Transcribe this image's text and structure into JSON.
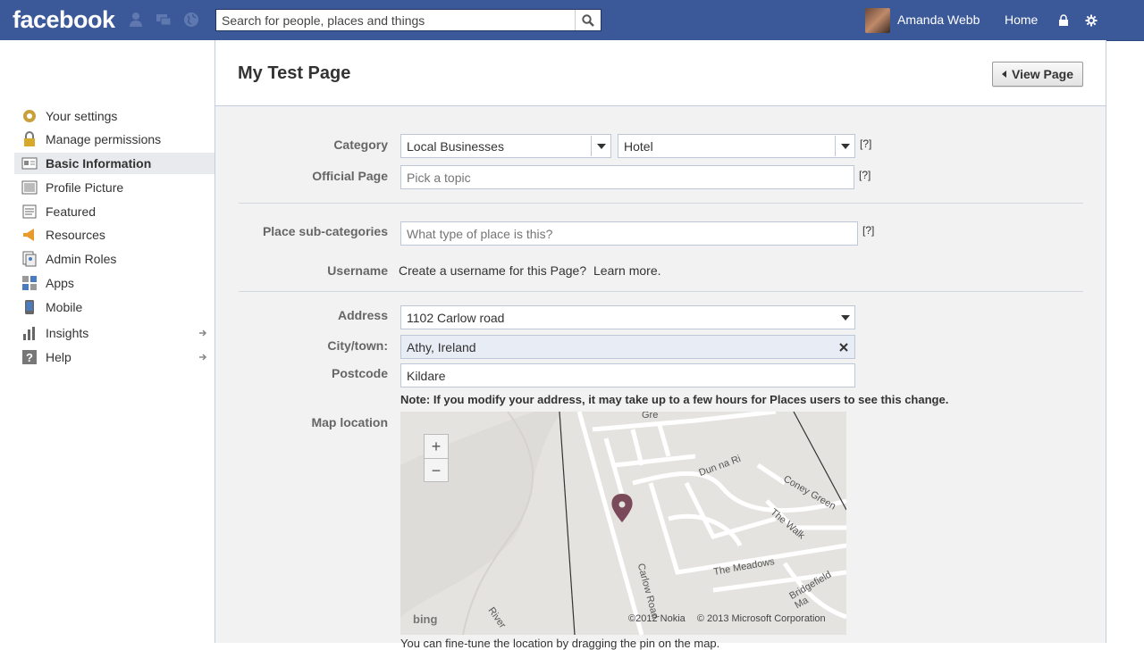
{
  "topbar": {
    "logo": "facebook",
    "search_placeholder": "Search for people, places and things",
    "user_name": "Amanda Webb",
    "home_label": "Home"
  },
  "sidebar": {
    "items": [
      {
        "label": "Your settings",
        "icon": "gear-icon"
      },
      {
        "label": "Manage permissions",
        "icon": "lock-icon"
      },
      {
        "label": "Basic Information",
        "icon": "info-card-icon",
        "active": true
      },
      {
        "label": "Profile Picture",
        "icon": "picture-icon"
      },
      {
        "label": "Featured",
        "icon": "featured-icon"
      },
      {
        "label": "Resources",
        "icon": "megaphone-icon"
      },
      {
        "label": "Admin Roles",
        "icon": "admin-icon"
      },
      {
        "label": "Apps",
        "icon": "apps-icon"
      },
      {
        "label": "Mobile",
        "icon": "mobile-icon"
      },
      {
        "label": "Insights",
        "icon": "insights-icon",
        "arrow": true
      },
      {
        "label": "Help",
        "icon": "help-icon",
        "arrow": true
      }
    ]
  },
  "page": {
    "title": "My Test Page",
    "view_page_label": "View Page"
  },
  "form": {
    "category_label": "Category",
    "category_value": "Local Businesses",
    "subcategory_value": "Hotel",
    "help_mark": "[?]",
    "official_page_label": "Official Page",
    "official_page_placeholder": "Pick a topic",
    "place_subcategories_label": "Place sub-categories",
    "place_subcategories_placeholder": "What type of place is this?",
    "username_label": "Username",
    "username_text": "Create a username for this Page?",
    "learn_more": "Learn more.",
    "address_label": "Address",
    "address_value": "1102 Carlow road",
    "city_label": "City/town:",
    "city_value": "Athy, Ireland",
    "postcode_label": "Postcode",
    "postcode_value": "Kildare",
    "note": "Note: If you modify your address, it may take up to a few hours for Places users to see this change.",
    "map_label": "Map location",
    "fine_tune": "You can fine-tune the location by dragging the pin on the map."
  },
  "map": {
    "streets": [
      "Dun na Ri",
      "Coney Green",
      "The Walk",
      "The Meadows",
      "Bridgefield Ma",
      "Carlow Road",
      "River",
      "Gre"
    ],
    "copyright_nokia": "©2012 Nokia",
    "copyright_ms": "© 2013 Microsoft Corporation",
    "bing": "bing",
    "pin_color": "#7a4a5a"
  },
  "colors": {
    "brand": "#3b5998"
  }
}
